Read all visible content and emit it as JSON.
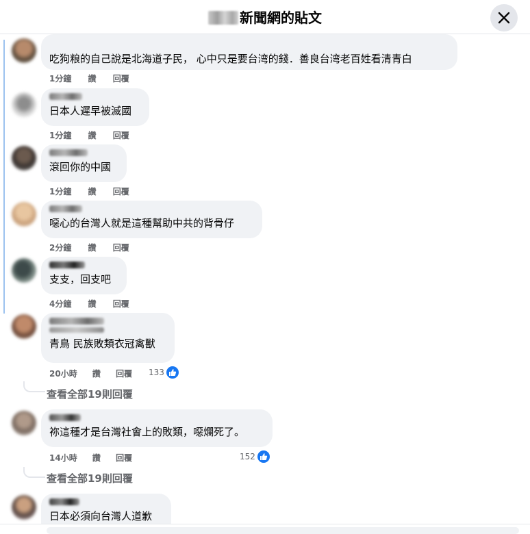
{
  "header": {
    "title_suffix": "新聞網的貼文",
    "close_icon": "close-icon"
  },
  "comments": [
    {
      "text": "吃狗粮的自己說是北海道子民， 心中只是要台湾的錢．善良台湾老百姓看清青白",
      "time": "1分鐘",
      "like_label": "讚",
      "reply_label": "回覆"
    },
    {
      "text": "日本人遲早被滅國",
      "time": "1分鐘",
      "like_label": "讚",
      "reply_label": "回覆"
    },
    {
      "text": "滾回你的中國",
      "time": "1分鐘",
      "like_label": "讚",
      "reply_label": "回覆"
    },
    {
      "text": "噁心的台灣人就是這種幫助中共的背骨仔",
      "time": "2分鐘",
      "like_label": "讚",
      "reply_label": "回覆"
    },
    {
      "text": "支支，回支吧",
      "time": "4分鐘",
      "like_label": "讚",
      "reply_label": "回覆"
    },
    {
      "text": "青鳥 民族敗類衣冠禽獸",
      "time": "20小時",
      "like_label": "讚",
      "reply_label": "回覆",
      "reaction_count": "133",
      "view_replies": "查看全部19則回覆"
    },
    {
      "text": "祢這種才是台灣社會上的敗類，噁爛死了。",
      "time": "14小時",
      "like_label": "讚",
      "reply_label": "回覆",
      "reaction_count": "152",
      "view_replies": "查看全部19則回覆"
    },
    {
      "text": "日本必須向台灣人道歉"
    }
  ],
  "colors": {
    "bubble": "#f0f2f5",
    "meta_text": "#65676b",
    "like_blue": "#1877f2"
  }
}
